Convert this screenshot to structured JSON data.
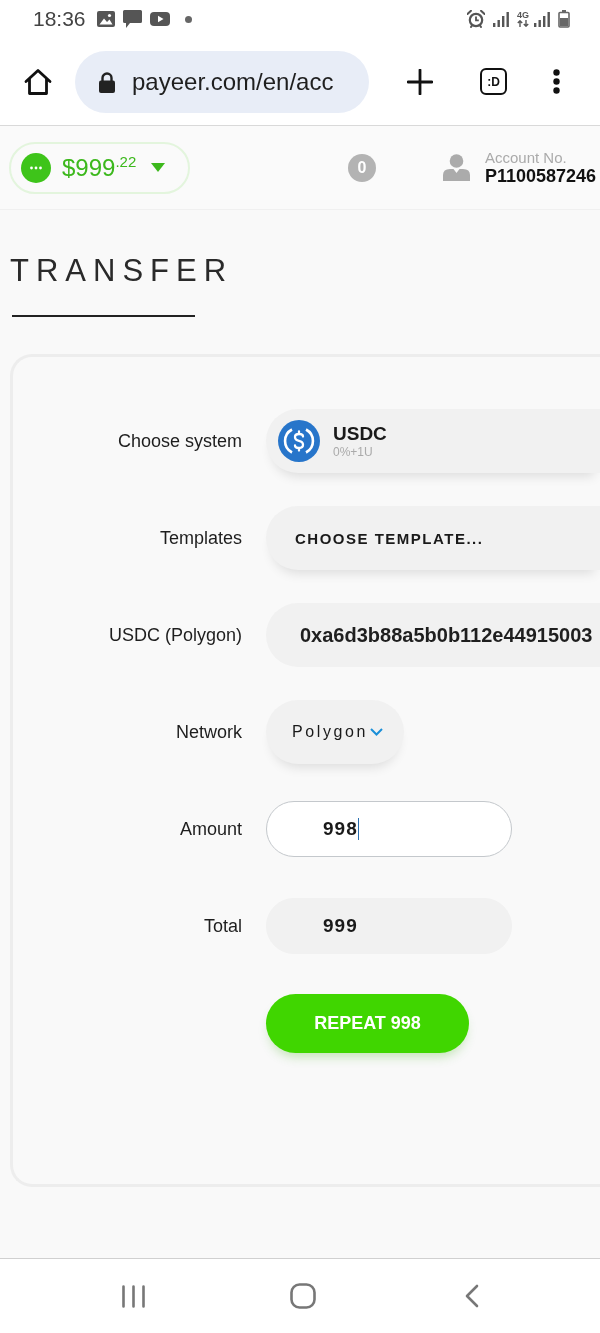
{
  "status_bar": {
    "time": "18:36",
    "network_type": "4G"
  },
  "browser": {
    "url": "payeer.com/en/acc",
    "tab_count": ":D"
  },
  "header": {
    "balance": "$999$^{.22}$",
    "notifications": "0",
    "account_label": "Account No.",
    "account_number": "P1100587246"
  },
  "page_title": "TRANSFER",
  "form": {
    "rows": [
      {
        "kind": "system",
        "label": "Choose system",
        "name": "USDC",
        "fee": "0%+1U"
      },
      {
        "kind": "select",
        "label": "Templates",
        "value": "CHOOSE TEMPLATE..."
      },
      {
        "kind": "address",
        "label": "USDC (Polygon)",
        "value": "0xa6d3b88a5b0b112e44915003"
      },
      {
        "kind": "dropdown",
        "label": "Network",
        "value": "Polygon"
      },
      {
        "kind": "input",
        "label": "Amount",
        "value": "998",
        "focused": true
      },
      {
        "kind": "output",
        "label": "Total",
        "value": "999"
      }
    ],
    "submit": {
      "label": "REPEAT 998"
    }
  }
}
